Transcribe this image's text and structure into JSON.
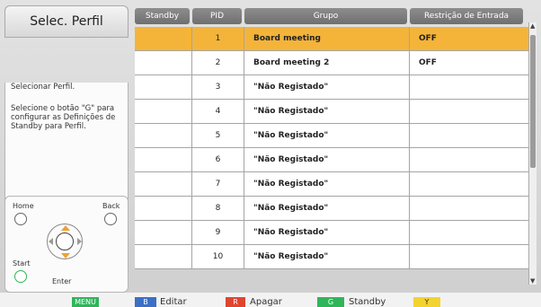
{
  "panel": {
    "title": "Selec. Perfil",
    "help_line1": "Selecionar Perfil.",
    "help_line2": "Selecione o botão \"G\" para configurar as Definições de Standby para Perfil."
  },
  "remote": {
    "home": "Home",
    "back": "Back",
    "start": "Start",
    "enter": "Enter"
  },
  "table": {
    "headers": [
      "Standby",
      "PID",
      "Grupo",
      "Restrição de Entrada"
    ],
    "rows": [
      {
        "standby": "",
        "pid": "1",
        "grupo": "Board meeting",
        "restricao": "OFF",
        "selected": true
      },
      {
        "standby": "",
        "pid": "2",
        "grupo": "Board meeting 2",
        "restricao": "OFF",
        "selected": false
      },
      {
        "standby": "",
        "pid": "3",
        "grupo": "\"Não Registado\"",
        "restricao": "",
        "selected": false
      },
      {
        "standby": "",
        "pid": "4",
        "grupo": "\"Não Registado\"",
        "restricao": "",
        "selected": false
      },
      {
        "standby": "",
        "pid": "5",
        "grupo": "\"Não Registado\"",
        "restricao": "",
        "selected": false
      },
      {
        "standby": "",
        "pid": "6",
        "grupo": "\"Não Registado\"",
        "restricao": "",
        "selected": false
      },
      {
        "standby": "",
        "pid": "7",
        "grupo": "\"Não Registado\"",
        "restricao": "",
        "selected": false
      },
      {
        "standby": "",
        "pid": "8",
        "grupo": "\"Não Registado\"",
        "restricao": "",
        "selected": false
      },
      {
        "standby": "",
        "pid": "9",
        "grupo": "\"Não Registado\"",
        "restricao": "",
        "selected": false
      },
      {
        "standby": "",
        "pid": "10",
        "grupo": "\"Não Registado\"",
        "restricao": "",
        "selected": false
      }
    ]
  },
  "bottom": {
    "menu_key": "MENU",
    "b_key": "B",
    "b_label": "Editar",
    "r_key": "R",
    "r_label": "Apagar",
    "g_key": "G",
    "g_label": "Standby",
    "y_key": "Y"
  },
  "colors": {
    "selected_row": "#f4b43a",
    "key_green": "#2fb55a",
    "key_blue": "#3c6fc6",
    "key_red": "#e0452f",
    "key_yellow": "#f3d330"
  }
}
